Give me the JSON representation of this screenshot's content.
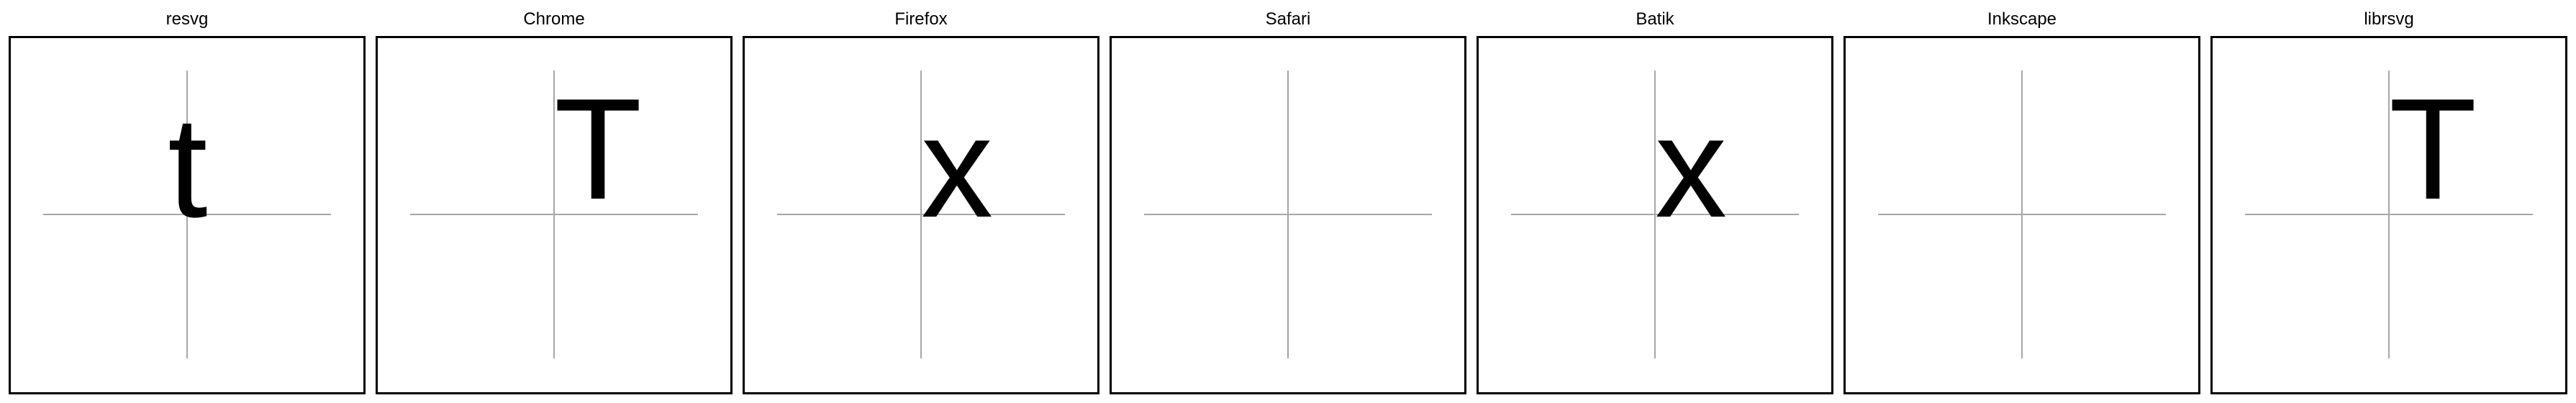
{
  "panels": [
    {
      "title": "resvg",
      "glyph": "t"
    },
    {
      "title": "Chrome",
      "glyph": "T"
    },
    {
      "title": "Firefox",
      "glyph": "x"
    },
    {
      "title": "Safari",
      "glyph": ""
    },
    {
      "title": "Batik",
      "glyph": "x"
    },
    {
      "title": "Inkscape",
      "glyph": ""
    },
    {
      "title": "librsvg",
      "glyph": "T"
    }
  ]
}
